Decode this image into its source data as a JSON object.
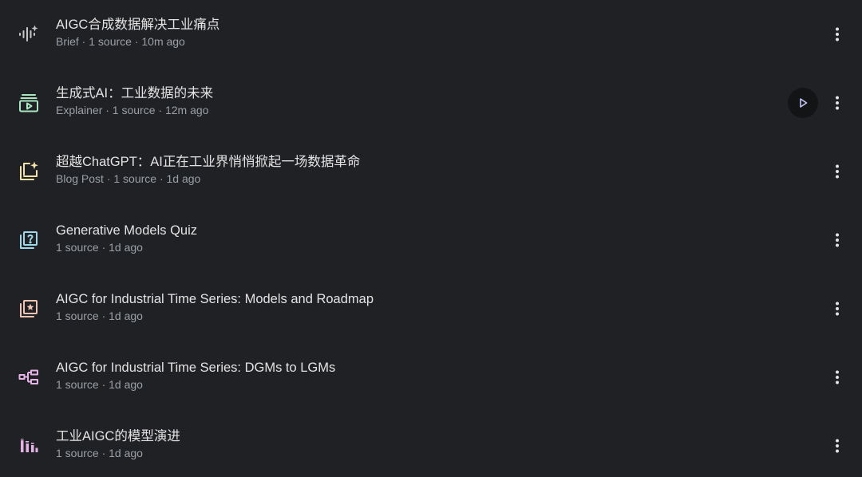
{
  "items": [
    {
      "title": "AIGC合成数据解决工业痛点",
      "meta": "Brief · 1 source · 10m ago",
      "icon": "audio-waveform-sparkle-icon",
      "icon_color": "#c4c7c5"
    },
    {
      "title": "生成式AI：工业数据的未来",
      "meta": "Explainer · 1 source · 12m ago",
      "icon": "video-playlist-icon",
      "icon_color": "#a8e6c1",
      "play_button": true
    },
    {
      "title": "超越ChatGPT：AI正在工业界悄悄掀起一场数据革命",
      "meta": "Blog Post · 1 source · 1d ago",
      "icon": "stacked-sparkle-note-icon",
      "icon_color": "#f3e3a8"
    },
    {
      "title": "Generative Models Quiz",
      "meta": "1 source · 1d ago",
      "icon": "quiz-question-icon",
      "icon_color": "#9fd8e8"
    },
    {
      "title": "AIGC for Industrial Time Series: Models and Roadmap",
      "meta": "1 source · 1d ago",
      "icon": "flashcards-star-icon",
      "icon_color": "#f2c4b3"
    },
    {
      "title": "AIGC for Industrial Time Series: DGMs to LGMs",
      "meta": "1 source · 1d ago",
      "icon": "mind-map-icon",
      "icon_color": "#e3b3e6"
    },
    {
      "title": "工业AIGC的模型演进",
      "meta": "1 source · 1d ago",
      "icon": "bar-chart-infographic-icon",
      "icon_color": "#e3b3e6"
    }
  ],
  "more_icon": "more-vert-icon",
  "play_icon": "play-icon"
}
